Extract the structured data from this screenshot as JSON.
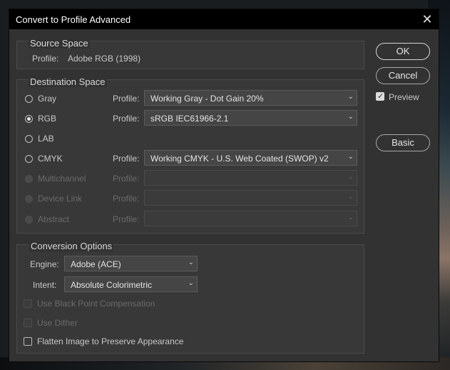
{
  "window": {
    "title": "Convert to Profile Advanced",
    "close_glyph": "✕"
  },
  "source": {
    "title": "Source Space",
    "profile_label": "Profile:",
    "profile_value": "Adobe RGB (1998)"
  },
  "destination": {
    "title": "Destination Space",
    "profile_label": "Profile:",
    "rows": [
      {
        "mode": "Gray",
        "selected": false,
        "enabled": true,
        "profile": "Working Gray - Dot Gain 20%"
      },
      {
        "mode": "RGB",
        "selected": true,
        "enabled": true,
        "profile": "sRGB IEC61966-2.1"
      },
      {
        "mode": "LAB",
        "selected": false,
        "enabled": true,
        "profile": ""
      },
      {
        "mode": "CMYK",
        "selected": false,
        "enabled": true,
        "profile": "Working CMYK - U.S. Web Coated (SWOP) v2"
      },
      {
        "mode": "Multichannel",
        "selected": false,
        "enabled": false,
        "profile": ""
      },
      {
        "mode": "Device Link",
        "selected": false,
        "enabled": false,
        "profile": ""
      },
      {
        "mode": "Abstract",
        "selected": false,
        "enabled": false,
        "profile": ""
      }
    ]
  },
  "conversion": {
    "title": "Conversion Options",
    "engine_label": "Engine:",
    "engine_value": "Adobe (ACE)",
    "intent_label": "Intent:",
    "intent_value": "Absolute Colorimetric",
    "options": [
      {
        "label": "Use Black Point Compensation",
        "checked": false,
        "enabled": false
      },
      {
        "label": "Use Dither",
        "checked": false,
        "enabled": false
      },
      {
        "label": "Flatten Image to Preserve Appearance",
        "checked": false,
        "enabled": true
      }
    ]
  },
  "buttons": {
    "ok": "OK",
    "cancel": "Cancel",
    "basic": "Basic"
  },
  "preview": {
    "label": "Preview",
    "checked": true
  }
}
